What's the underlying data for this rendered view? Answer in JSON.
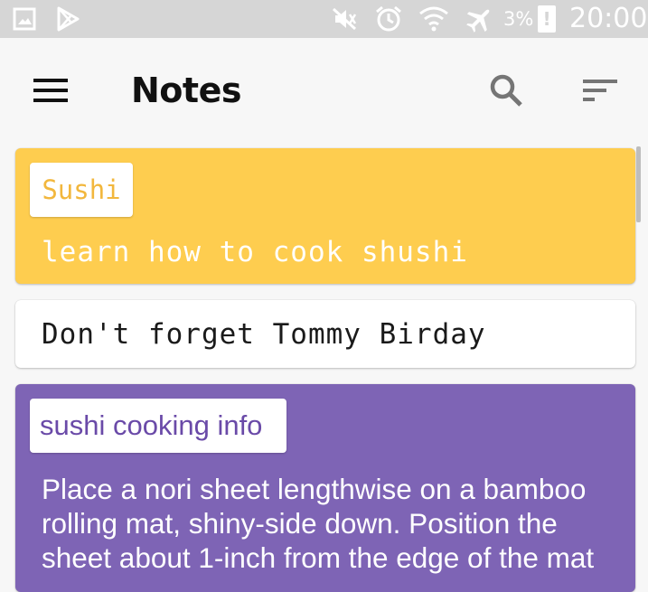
{
  "status_bar": {
    "battery": "3%",
    "battery_alert": "!",
    "time": "20:00",
    "icons": [
      "gallery-icon",
      "play-store-icon",
      "mute-icon",
      "alarm-icon",
      "wifi-icon",
      "airplane-mode-icon",
      "battery-icon"
    ]
  },
  "app_bar": {
    "title": "Notes",
    "icons": [
      "menu-icon",
      "search-icon",
      "sort-icon"
    ]
  },
  "notes": [
    {
      "title": "Sushi",
      "body": "learn how to cook shushi",
      "color": "#fecd4f"
    },
    {
      "title": "",
      "body": "Don't forget Tommy Birday",
      "color": "#ffffff"
    },
    {
      "title": "sushi cooking info",
      "body": "Place a nori sheet lengthwise on a bamboo rolling mat, shiny-side down. Position the sheet about 1-inch from the edge of the mat",
      "color": "#7e64b5"
    }
  ],
  "colors": {
    "status_bar": "#d6d6d6",
    "background": "#f7f7f7",
    "yellow_card": "#fecd4f",
    "yellow_text": "#f2b73d",
    "purple_card": "#7e64b5",
    "purple_text": "#6a4aa8"
  }
}
